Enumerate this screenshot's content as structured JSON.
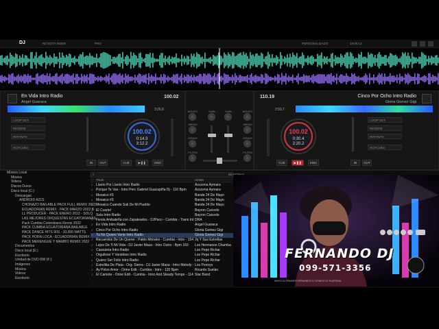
{
  "app": {
    "brand": "DJ",
    "topbar_text": [
      "NO ESTA INSER",
      "PRO",
      "PERSONALIZADO",
      "19:05:13"
    ]
  },
  "deckA": {
    "title": "En Vida Intro Radio",
    "artist": "Angel Guaraca",
    "bpm": "100.02",
    "jog_bpm": "100.02",
    "time_elapsed": "0:14.3",
    "time_remain": "3:12.2",
    "key": "3:26.6",
    "buttons": {
      "loop": "LOOP OUT",
      "reverb": "REVERB",
      "wah": "WAHWAH",
      "hotcues": "HOTCUES",
      "in": "IN",
      "out": "OUT",
      "cue": "CUE",
      "play": "▶❚❚",
      "sync": "SINC"
    }
  },
  "deckB": {
    "title": "Cinco Por Ocho Intro Radio",
    "artist": "Gloria Gomez Gigi",
    "bpm": "110.19",
    "jog_bpm": "100.02",
    "time_elapsed": "0:30.4",
    "time_remain": "2:20.2",
    "key": "2:50.7",
    "buttons": {
      "loop": "LOOP OUT",
      "reverb": "REVERB",
      "wah": "WAHWAH",
      "hotcues": "HOTCUES",
      "in": "IN",
      "out": "OUT",
      "cue": "CUE",
      "play": "▶❚❚",
      "sync": "SINC"
    }
  },
  "mixer": {
    "agudo": "AGUDO",
    "medio": "MEDIO",
    "grave": "GRAVE",
    "filtro": "FILTRO",
    "gain": "GAIN"
  },
  "tree": [
    "Música Local",
    "Música",
    "Videos",
    "Discos Duros",
    "Disco local (C:)",
    "Descargas",
    "ANDROID A21S",
    "CHONAZO BAILABLE PACK FULL REMIX 2022",
    "ECUADORIAN REMIX - PACK MARZO 2022 B",
    "LL PRODUCER - PACK ENERO 2022 - SOLO",
    "LAS MEJORES ORQUESTAS ECUATORIANAS",
    "Pack Cumbia Colombiana Remix 2022",
    "PACK CUMBIA ECUATORIANA BAILABLE",
    "PACK DANCE HITS 90S - 10,000 WATTS",
    "PACK HORA LOCA - ECUADORIAN REMIX",
    "PACK MERENGUE Y MAMBO REMIX 2022",
    "Documentos",
    "Disco local (E:)",
    "Escritorio",
    "Unidad de DVD RW (F:)",
    "Imágenes",
    "Música",
    "Videos",
    "Escritorio"
  ],
  "search": {
    "placeholder": "",
    "count": "22 archivos"
  },
  "columns": {
    "title": "Título",
    "artist": "Artista"
  },
  "rows": [
    {
      "title": "Llanto Por Llanto Intro Radio",
      "artist": "Azucena Aymara"
    },
    {
      "title": "Porque Te Vas - Intro Perc Gabriel Guacapiña Dj - 116 Bpm",
      "artist": "Azucena Aymara"
    },
    {
      "title": "Mosaico #3",
      "artist": "Banda 24 De Mayo"
    },
    {
      "title": "Mosaico #3",
      "artist": "Banda 24 De Mayo"
    },
    {
      "title": "Mosaico Cuando Sali De Mi Pueblo",
      "artist": "Banda 24 De Mayo"
    },
    {
      "title": "El Cuartel",
      "artist": "Bayron Caicedo"
    },
    {
      "title": "Sola Intro Radio",
      "artist": "Bayron Caicedo"
    },
    {
      "title": "Fiesta Ambateña con Zapateados - DJPaco - Cumbia - Trans Intr - 112 122 Bpm",
      "artist": "DRA"
    },
    {
      "title": "En Vida Intro Radio",
      "artist": "Angel Guaraca"
    },
    {
      "title": "Cinco Por Ocho Intro Radio",
      "artist": "Gloria Gomez Gigi"
    },
    {
      "title": "Ya No Quiero Verte Intro Radio",
      "artist": "Gloria Gomez Gigi"
    },
    {
      "title": "Recuerdos De Un Querer - Pablo Morales - Cumbia - Intro - 154 Bpm",
      "artist": "Jq Y Sus Estrellas"
    },
    {
      "title": "Lejos De Ti Mi Vida - DJ Javier Maza - Intro Outro - Bpm 160",
      "artist": "Los Hermanos Chamba"
    },
    {
      "title": "Cassuleta Intro Radio",
      "artist": "Los Pepe Richar"
    },
    {
      "title": "Orgulloso Y Vanidoso Intro Radio",
      "artist": "Los Pepe Richar"
    },
    {
      "title": "Quiero Ser Feliz Intro Radio",
      "artist": "Los Pepe Richar"
    },
    {
      "title": "Estrellita De Plata - Org. Sierra - DJ Javier Maza - Intro Melody - Bpm 160",
      "artist": "Los Ponnys"
    },
    {
      "title": "Ay Polvo Amor - Orine Edit - Cumbia - Intro - 120 Bpm",
      "artist": "Ricardo Suelan"
    },
    {
      "title": "El Camote - Orine Edit - Cumbia - Intro And Steady Tempo - 114 Bpm",
      "artist": "Star Band"
    }
  ],
  "promo": {
    "name": "FERNANDO DJ",
    "phone": "099-571-3356",
    "footer": "MIXES DJ REMIXES FERNANDO DJ SONIDO DJ SUSTENAL"
  },
  "colors": {
    "accent_blue": "#3a6ad8",
    "accent_red": "#d8323a",
    "selected_row": "#2a3a5a"
  }
}
